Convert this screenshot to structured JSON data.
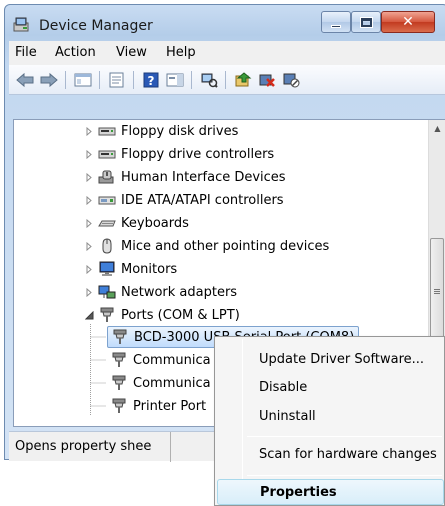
{
  "window": {
    "title": "Device Manager"
  },
  "menu": [
    "File",
    "Action",
    "View",
    "Help"
  ],
  "toolbar": {
    "icons": [
      "back-arrow-icon",
      "forward-arrow-icon",
      "show-hide-tree-icon",
      "properties-icon",
      "help-icon",
      "action-pane-icon",
      "scan-hardware-icon",
      "update-driver-icon",
      "uninstall-icon",
      "disable-icon"
    ]
  },
  "tree": {
    "categories": [
      "Floppy disk drives",
      "Floppy drive controllers",
      "Human Interface Devices",
      "IDE ATA/ATAPI controllers",
      "Keyboards",
      "Mice and other pointing devices",
      "Monitors",
      "Network adapters",
      "Ports (COM & LPT)"
    ],
    "ports": [
      "BCD-3000 USB Serial Port (COM8)",
      "Communica",
      "Communica",
      "Printer Port"
    ]
  },
  "status": {
    "text": "Opens property shee"
  },
  "context_menu": {
    "items": [
      "Update Driver Software...",
      "Disable",
      "Uninstall",
      "Scan for hardware changes",
      "Properties"
    ],
    "default_item": "Properties"
  },
  "colors": {
    "title_gradient": "#c9dcf2",
    "selection": "#c1dcfc",
    "close_button": "#c23a20"
  }
}
